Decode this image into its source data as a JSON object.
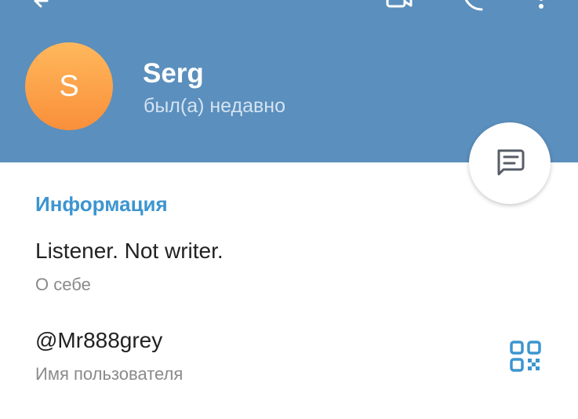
{
  "profile": {
    "avatar_letter": "S",
    "name": "Serg",
    "status": "был(а) недавно"
  },
  "info": {
    "section_title": "Информация",
    "bio_value": "Listener. Not writer.",
    "bio_label": "О себе",
    "username_value": "@Mr888grey",
    "username_label": "Имя пользователя"
  },
  "icons": {
    "header_back": "back-arrow-icon",
    "header_video": "video-call-icon",
    "header_call": "phone-icon",
    "header_more": "more-vertical-icon",
    "fab": "message-icon",
    "qr": "qr-code-icon"
  },
  "colors": {
    "header_bg": "#5b8fbd",
    "accent": "#3d95d0",
    "avatar_top": "#ffb85c",
    "avatar_bottom": "#f98f3a"
  }
}
